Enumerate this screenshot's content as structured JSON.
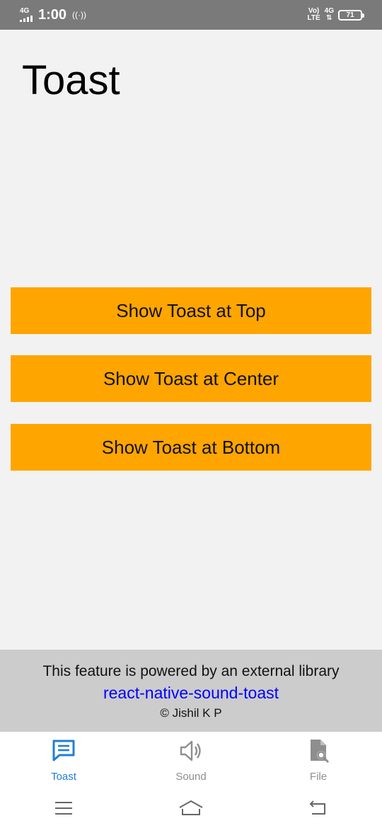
{
  "status_bar": {
    "network_left": "4G",
    "time": "1:00",
    "volte_top": "Vo)",
    "volte_bottom": "LTE",
    "network_right": "4G",
    "battery": "71"
  },
  "page": {
    "title": "Toast"
  },
  "buttons": {
    "top_label": "Show Toast at Top",
    "center_label": "Show Toast at Center",
    "bottom_label": "Show Toast at Bottom",
    "color": "#ffa500"
  },
  "footer": {
    "line1": "This feature is powered by an external library",
    "library_link": "react-native-sound-toast",
    "credit": "© Jishil K P",
    "background": "#cccccc",
    "link_color": "#0000ff"
  },
  "tabs": [
    {
      "label": "Toast",
      "icon": "message-icon",
      "active": true
    },
    {
      "label": "Sound",
      "icon": "speaker-icon",
      "active": false
    },
    {
      "label": "File",
      "icon": "file-search-icon",
      "active": false
    }
  ],
  "colors": {
    "active_tab": "#1f7fd6",
    "inactive_tab": "#8e8e8e"
  },
  "system_nav": {
    "icons": [
      "menu-icon",
      "home-icon",
      "back-icon"
    ]
  }
}
